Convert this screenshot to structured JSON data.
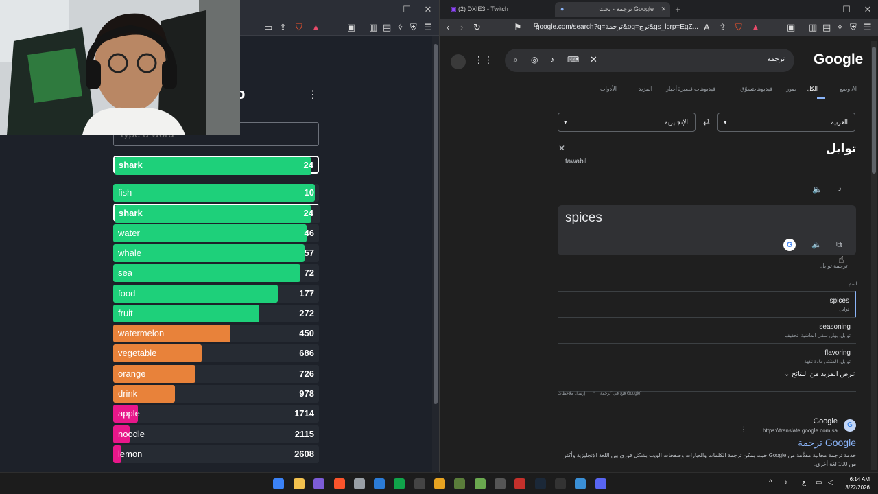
{
  "left_window": {
    "game_title_fragment": "o",
    "input_placeholder": "type a word",
    "current_guess": {
      "word": "shark",
      "rank": "24",
      "fill": 0.97
    },
    "guesses": [
      {
        "word": "fish",
        "rank": "10",
        "fill": 0.98,
        "color": "#1ed07a"
      },
      {
        "word": "shark",
        "rank": "24",
        "fill": 0.97,
        "color": "#1ed07a",
        "highlight": true
      },
      {
        "word": "water",
        "rank": "46",
        "fill": 0.94,
        "color": "#1ed07a"
      },
      {
        "word": "whale",
        "rank": "57",
        "fill": 0.93,
        "color": "#1ed07a"
      },
      {
        "word": "sea",
        "rank": "72",
        "fill": 0.91,
        "color": "#1ed07a"
      },
      {
        "word": "food",
        "rank": "177",
        "fill": 0.8,
        "color": "#1ed07a"
      },
      {
        "word": "fruit",
        "rank": "272",
        "fill": 0.71,
        "color": "#1ed07a"
      },
      {
        "word": "watermelon",
        "rank": "450",
        "fill": 0.57,
        "color": "#e8823a"
      },
      {
        "word": "vegetable",
        "rank": "686",
        "fill": 0.43,
        "color": "#e8823a"
      },
      {
        "word": "orange",
        "rank": "726",
        "fill": 0.4,
        "color": "#e8823a"
      },
      {
        "word": "drink",
        "rank": "978",
        "fill": 0.3,
        "color": "#e8823a"
      },
      {
        "word": "apple",
        "rank": "1714",
        "fill": 0.12,
        "color": "#e8178a"
      },
      {
        "word": "noodle",
        "rank": "2115",
        "fill": 0.08,
        "color": "#e8178a"
      },
      {
        "word": "lemon",
        "rank": "2608",
        "fill": 0.04,
        "color": "#e8178a"
      }
    ]
  },
  "right_window": {
    "tabs": [
      {
        "label": "(2) DXIE3 - Twitch"
      },
      {
        "label": "ترجمة - بحث Google"
      }
    ],
    "url": "google.com/search?q=ترجمة&oq=ترج&gs_lcrp=EgZ...",
    "search_query": "ترجمة",
    "google_logo": "Google",
    "search_tabs": [
      "وضع AI",
      "الكل",
      "صور",
      "فيديوهات",
      "تسوّق",
      "فيديوهات قصيرة",
      "أخبار",
      "المزيد",
      "الأدوات"
    ],
    "source_lang": "العربية",
    "target_lang": "الإنجليزية",
    "source_text": "توابل",
    "transliteration": "tawabil",
    "translation": "spices",
    "tooltip": "ترجمة توابل",
    "dict_label": "اسم",
    "dict_entries": [
      {
        "word": "spices",
        "translations": "توابل"
      },
      {
        "word": "seasoning",
        "translations": "توابل, بهار, سقي الماشية, تحفيف"
      },
      {
        "word": "flavoring",
        "translations": "توابل, المنكه, مادة نكهة"
      }
    ],
    "more_results": "عرض المزيد من النتائج",
    "footer_links": [
      "فتح في \"ترجمة Google\"",
      "إرسال ملاحظات"
    ],
    "result": {
      "site": "Google",
      "url": "https://translate.google.com.sa",
      "title": "ترجمة Google",
      "snippet": "خدمة ترجمة مجانية مقدَّمة من Google حيث يمكن ترجمة الكلمات والعبارات وصفحات الويب بشكل فوري بين اللغة الإنجليزية وأكثر من 100 لغة أخرى."
    }
  },
  "taskbar": {
    "time": "6:14 AM",
    "date": "3/22/2026",
    "lang": "ع"
  }
}
